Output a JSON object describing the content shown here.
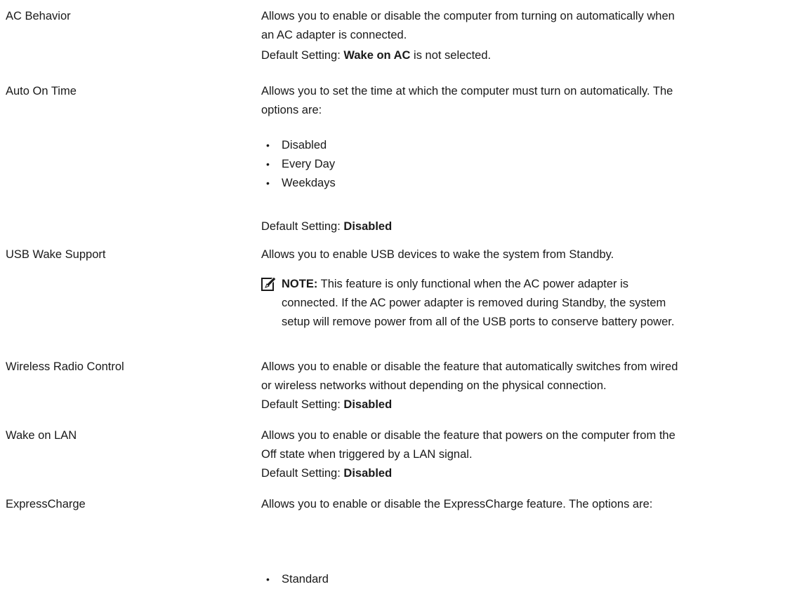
{
  "rows": {
    "ac_behavior": {
      "option": "AC Behavior",
      "desc_lines": [
        "Allows you to enable or disable the computer from turning on automatically when",
        "an AC adapter is connected."
      ],
      "default_prefix": "Default Setting: ",
      "default_value": "Wake on AC",
      "default_suffix": " is not selected."
    },
    "auto_on_time": {
      "option": "Auto On Time",
      "desc_lines": [
        "Allows you to set the time at which the computer must turn on automatically. The",
        "options are:"
      ],
      "options": [
        "Disabled",
        "Every Day",
        "Weekdays"
      ],
      "default_prefix": "Default Setting: ",
      "default_value": "Disabled"
    },
    "usb_wake_support": {
      "option": "USB Wake Support",
      "desc_lines": [
        "Allows you to enable USB devices to wake the system from Standby."
      ],
      "note_label": "NOTE:",
      "note_lines": [
        " This feature is only functional when the AC power adapter is",
        "connected. If the AC power adapter is removed during Standby, the system",
        "setup will remove power from all of the USB ports to conserve battery power."
      ],
      "note_icon": "note-pencil-icon"
    },
    "wireless_radio_control": {
      "option": "Wireless Radio Control",
      "desc_lines": [
        "Allows you to enable or disable the feature that automatically switches from wired",
        "or wireless networks without depending on the physical connection."
      ],
      "default_prefix": "Default Setting: ",
      "default_value": "Disabled"
    },
    "wake_on_lan": {
      "option": "Wake on LAN",
      "desc_lines": [
        "Allows you to enable or disable the feature that powers on the computer from the",
        "Off state when triggered by a LAN signal."
      ],
      "default_prefix": "Default Setting: ",
      "default_value": "Disabled"
    },
    "express_charge": {
      "option": "ExpressCharge",
      "desc_lines": [
        "Allows you to enable or disable the ExpressCharge feature. The options are:"
      ],
      "options": [
        "Standard"
      ]
    }
  }
}
